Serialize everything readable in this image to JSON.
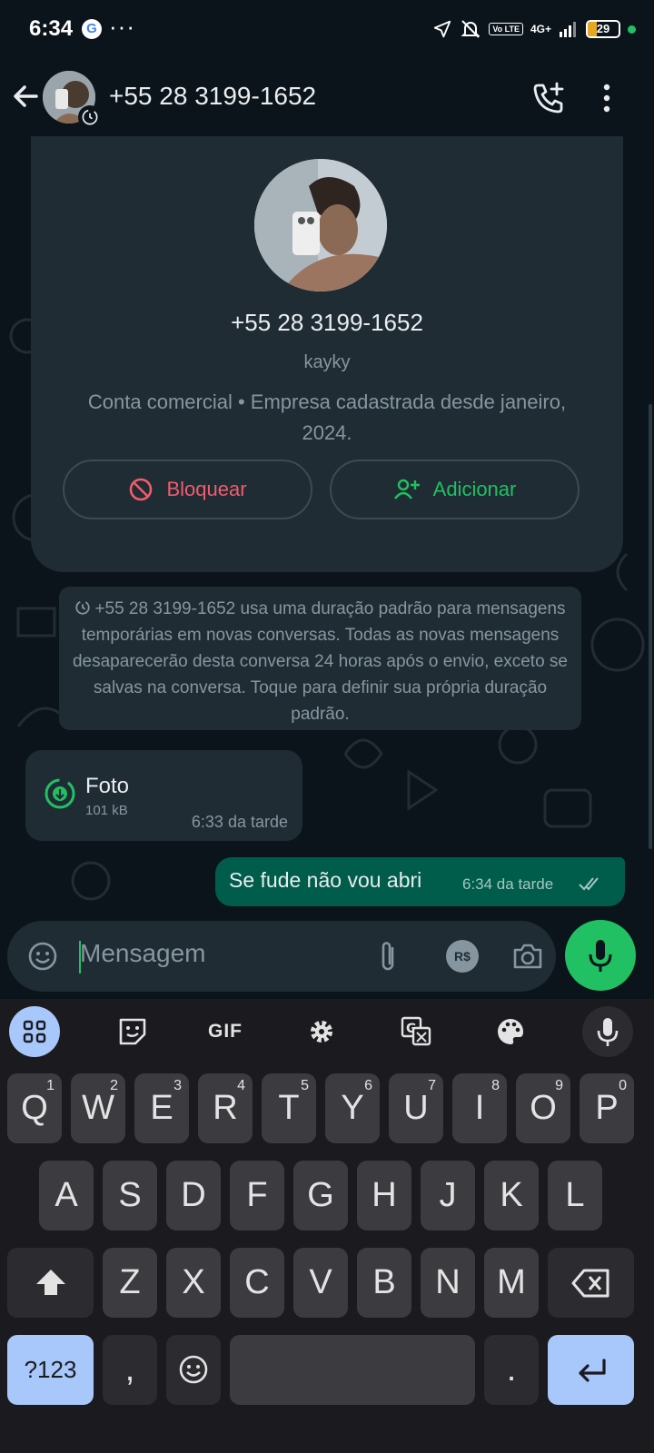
{
  "status_bar": {
    "time": "6:34",
    "google_letter": "G",
    "overflow": "···",
    "volte": "Vo LTE",
    "network": "4G+",
    "battery": "29",
    "battery_level": 0.29
  },
  "header": {
    "title": "+55 28 3199-1652"
  },
  "profile_card": {
    "phone": "+55 28 3199-1652",
    "name": "kayky",
    "info": "Conta comercial • Empresa cadastrada desde janeiro, 2024.",
    "block_label": "Bloquear",
    "add_label": "Adicionar"
  },
  "system_message": {
    "text": "+55 28 3199-1652 usa uma duração padrão para mensagens temporárias em novas conversas. Todas as novas mensagens desaparecerão desta conversa 24 horas após o envio, exceto se salvas na conversa. Toque para definir sua própria duração padrão."
  },
  "messages": [
    {
      "direction": "in",
      "type": "photo",
      "title": "Foto",
      "size": "101 kB",
      "time": "6:33 da tarde"
    },
    {
      "direction": "out",
      "type": "text",
      "text": "Se fude não vou abri",
      "time": "6:34 da tarde"
    }
  ],
  "composer": {
    "placeholder": "Mensagem",
    "payment_label": "R$"
  },
  "keyboard": {
    "toolbar_gif": "GIF",
    "row1": [
      {
        "key": "Q",
        "hint": "1"
      },
      {
        "key": "W",
        "hint": "2"
      },
      {
        "key": "E",
        "hint": "3"
      },
      {
        "key": "R",
        "hint": "4"
      },
      {
        "key": "T",
        "hint": "5"
      },
      {
        "key": "Y",
        "hint": "6"
      },
      {
        "key": "U",
        "hint": "7"
      },
      {
        "key": "I",
        "hint": "8"
      },
      {
        "key": "O",
        "hint": "9"
      },
      {
        "key": "P",
        "hint": "0"
      }
    ],
    "row2": [
      "A",
      "S",
      "D",
      "F",
      "G",
      "H",
      "J",
      "K",
      "L"
    ],
    "row3": [
      "Z",
      "X",
      "C",
      "V",
      "B",
      "N",
      "M"
    ],
    "symbols_label": "?123",
    "comma": ",",
    "period": "."
  },
  "colors": {
    "background": "#0b141a",
    "bubble_in": "#1f2c33",
    "bubble_out": "#005c4b",
    "accent_green": "#21c063",
    "danger_red": "#f15c6d",
    "keyboard_bg": "#1b1b1f",
    "key_bg": "#3c3c40",
    "key_accent": "#a8c7fa"
  }
}
